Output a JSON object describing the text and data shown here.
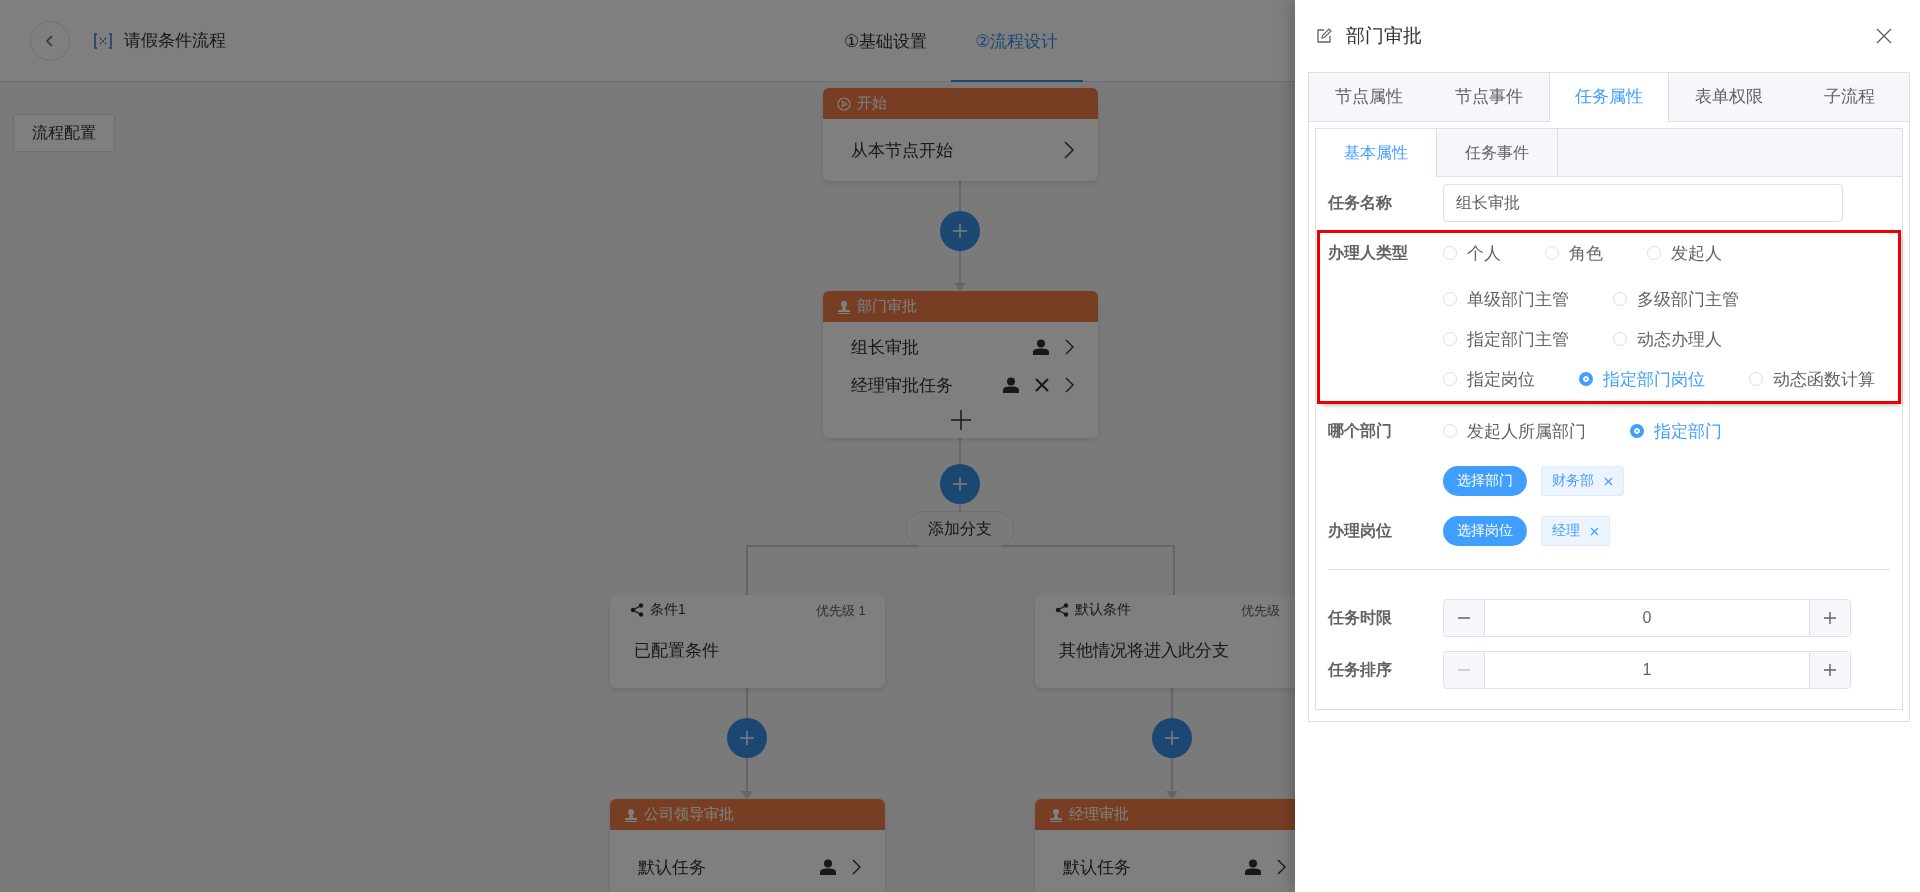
{
  "header": {
    "title": "请假条件流程",
    "steps": [
      {
        "label": "①基础设置",
        "selected": false
      },
      {
        "label": "②流程设计",
        "selected": true
      }
    ]
  },
  "toolbar": {
    "config_button": "流程配置"
  },
  "flow": {
    "start": {
      "title": "开始",
      "text": "从本节点开始"
    },
    "approval": {
      "title": "部门审批",
      "tasks": [
        {
          "name": "组长审批",
          "removable": false
        },
        {
          "name": "经理审批任务",
          "removable": true
        }
      ]
    },
    "add_branch": "添加分支",
    "branches": [
      {
        "title": "条件1",
        "priority": "优先级 1",
        "text": "已配置条件",
        "node": {
          "title": "公司领导审批",
          "tasks": [
            {
              "name": "默认任务",
              "removable": false
            }
          ]
        }
      },
      {
        "title": "默认条件",
        "priority": "优先级",
        "text": "其他情况将进入此分支",
        "node": {
          "title": "经理审批",
          "tasks": [
            {
              "name": "默认任务",
              "removable": false
            }
          ]
        }
      }
    ]
  },
  "drawer": {
    "title": "部门审批",
    "tabs": [
      {
        "label": "节点属性",
        "selected": false
      },
      {
        "label": "节点事件",
        "selected": false
      },
      {
        "label": "任务属性",
        "selected": true
      },
      {
        "label": "表单权限",
        "selected": false
      },
      {
        "label": "子流程",
        "selected": false
      }
    ],
    "subtabs": [
      {
        "label": "基本属性",
        "selected": true
      },
      {
        "label": "任务事件",
        "selected": false
      }
    ],
    "task_name": {
      "label": "任务名称",
      "value": "组长审批"
    },
    "handler_type": {
      "label": "办理人类型",
      "highlighted": true,
      "options": [
        {
          "label": "个人",
          "selected": false
        },
        {
          "label": "角色",
          "selected": false
        },
        {
          "label": "发起人",
          "selected": false
        },
        {
          "label": "单级部门主管",
          "selected": false
        },
        {
          "label": "多级部门主管",
          "selected": false
        },
        {
          "label": "指定部门主管",
          "selected": false
        },
        {
          "label": "动态办理人",
          "selected": false
        },
        {
          "label": "指定岗位",
          "selected": false
        },
        {
          "label": "指定部门岗位",
          "selected": true
        },
        {
          "label": "动态函数计算",
          "selected": false
        }
      ]
    },
    "department": {
      "label": "哪个部门",
      "options": [
        {
          "label": "发起人所属部门",
          "selected": false
        },
        {
          "label": "指定部门",
          "selected": true
        }
      ],
      "button": "选择部门",
      "tags": [
        "财务部"
      ]
    },
    "position": {
      "label": "办理岗位",
      "button": "选择岗位",
      "tags": [
        "经理"
      ]
    },
    "number_fields": [
      {
        "label": "任务时限",
        "value": "0",
        "decrease_disabled": false
      },
      {
        "label": "任务排序",
        "value": "1",
        "decrease_disabled": true
      }
    ]
  }
}
